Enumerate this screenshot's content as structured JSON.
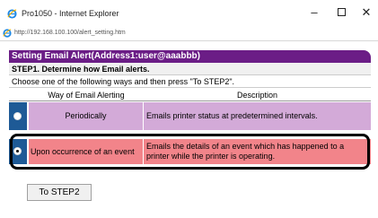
{
  "window": {
    "title": "Pro1050 - Internet Explorer",
    "minimize_glyph": "–",
    "close_glyph": "✕"
  },
  "addressbar": {
    "url": "http://192.168.100.100/alert_setting.htm"
  },
  "panel": {
    "title": "Setting Email Alert(Address1:user@aaabbb)",
    "step": "STEP1. Determine how Email alerts.",
    "instruction": "Choose one of the following ways and then press \"To STEP2\"."
  },
  "table": {
    "headers": {
      "method": "Way of Email Alerting",
      "description": "Description"
    },
    "options": [
      {
        "method": "Periodically",
        "description": "Emails printer status at predetermined intervals.",
        "selected": false
      },
      {
        "method": "Upon occurrence of an event",
        "description": "Emails the details of an event which has happened to a printer while the printer is operating.",
        "selected": true
      }
    ]
  },
  "buttons": {
    "next": "To STEP2"
  },
  "colors": {
    "panel_header": "#6b1d86",
    "radio_column": "#1e5a96",
    "row_periodic": "#d3aad8",
    "row_event": "#f2848a",
    "highlight_outline": "#000000"
  },
  "icons": {
    "title": "internet-explorer-icon",
    "address": "internet-explorer-icon"
  }
}
